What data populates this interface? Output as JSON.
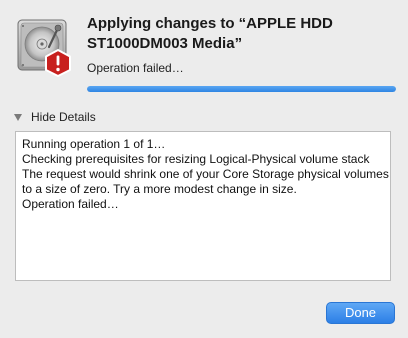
{
  "dialog": {
    "title": "Applying changes to “APPLE HDD ST1000DM003 Media”",
    "status": "Operation failed…",
    "progress_percent": 100,
    "icon": "hard-disk-alert-icon",
    "accent_color": "#2e85e3",
    "alert_color": "#c8201e"
  },
  "details": {
    "toggle_label": "Hide Details",
    "toggle_icon": "disclosure-triangle-down-icon",
    "log_lines": [
      "Running operation 1 of 1…",
      "Checking prerequisites for resizing Logical-Physical volume stack",
      "The request would shrink one of your Core Storage physical volumes",
      "to a size of zero. Try a more modest change in size.",
      "Operation failed…"
    ]
  },
  "buttons": {
    "done_label": "Done"
  }
}
